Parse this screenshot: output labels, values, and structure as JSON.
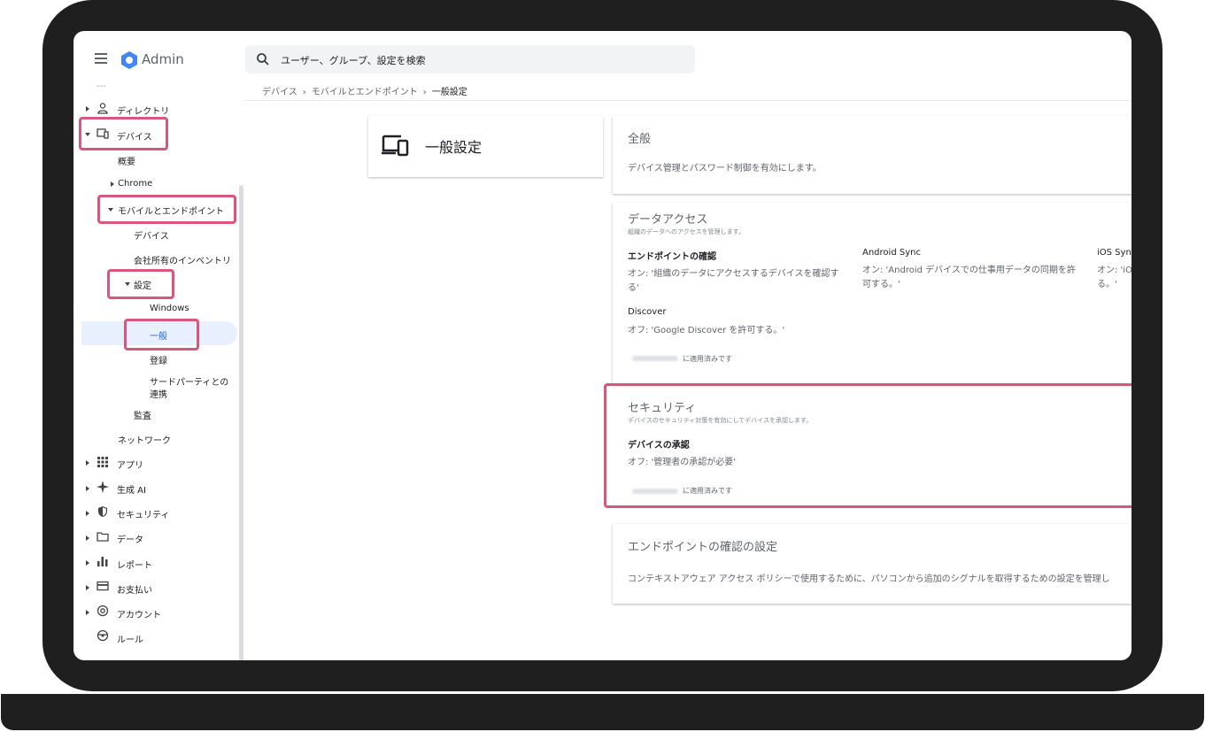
{
  "app": {
    "title": "Admin"
  },
  "search": {
    "placeholder": "ユーザー、グループ、設定を検索"
  },
  "breadcrumb": {
    "items": [
      "デバイス",
      "モバイルとエンドポイント",
      "一般設定"
    ],
    "separator": "›"
  },
  "sidebar": {
    "items": {
      "top_cut": "---",
      "directory": "ディレクトリ",
      "devices": "デバイス",
      "overview": "概要",
      "chrome": "Chrome",
      "mobile_endpoints": "モバイルとエンドポイント",
      "mobile_devices": "デバイス",
      "company_inventory": "会社所有のインベントリ",
      "settings": "設定",
      "windows": "Windows",
      "general": "一般",
      "enrollment": "登録",
      "third_party_line1": "サードパーティとの",
      "third_party_line2": "連携",
      "audit": "監査",
      "networks": "ネットワーク",
      "apps": "アプリ",
      "gen_ai": "生成 AI",
      "security": "セキュリティ",
      "data": "データ",
      "reports": "レポート",
      "billing": "お支払い",
      "account": "アカウント",
      "rules": "ルール"
    }
  },
  "header_card": {
    "title": "一般設定"
  },
  "sections": {
    "general": {
      "title": "全般",
      "description": "デバイス管理とパスワード制御を有効にします。"
    },
    "data_access": {
      "title": "データアクセス",
      "subtitle": "組織のデータへのアクセスを管理します。",
      "endpoint_verification": {
        "label": "エンドポイントの確認",
        "value_line1": "オン: '組織のデータにアクセスするデバイスを確認す",
        "value_line2": "る'"
      },
      "android_sync": {
        "label": "Android Sync",
        "value_line1": "オン: 'Android デバイスでの仕事用データの同期を許",
        "value_line2": "可する。'"
      },
      "ios_sync": {
        "label": "iOS Sync",
        "value_line1": "オン: 'iO",
        "value_line2": "る。'"
      },
      "discover": {
        "label": "Discover",
        "value": "オフ: 'Google Discover を許可する。'"
      },
      "applied": "に適用済みです"
    },
    "security": {
      "title": "セキュリティ",
      "subtitle": "デバイスのセキュリティ対策を有効にしてデバイスを承認します。",
      "device_approval": {
        "label": "デバイスの承認",
        "value": "オフ: '管理者の承認が必要'"
      },
      "applied": "に適用済みです"
    },
    "endpoint_settings": {
      "title": "エンドポイントの確認の設定",
      "description": "コンテキストアウェア アクセス ポリシーで使用するために、パソコンから追加のシグナルを取得するための設定を管理し"
    }
  },
  "colors": {
    "highlight": "#d6587c",
    "active_bg": "#e8f0fe",
    "laptop": "#1f1f1f"
  }
}
